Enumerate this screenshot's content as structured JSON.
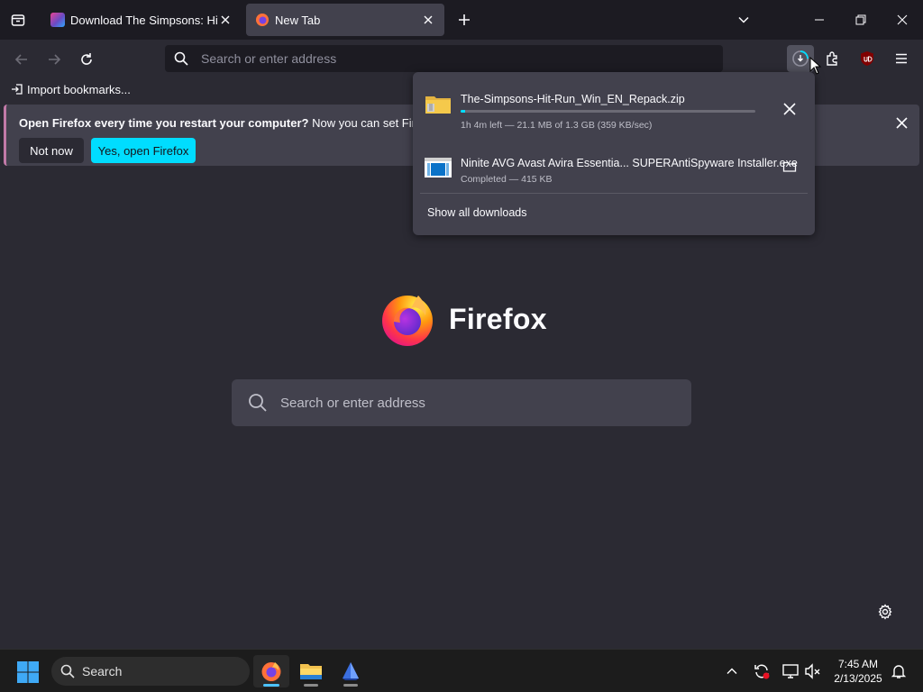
{
  "tabs": [
    {
      "title": "Download The Simpsons: Hit & Run",
      "favicon_color": "#6a4bc4"
    },
    {
      "title": "New Tab",
      "active": true
    }
  ],
  "navbar": {
    "url_placeholder": "Search or enter address"
  },
  "bookmarks_bar": {
    "import_label": "Import bookmarks..."
  },
  "notification": {
    "message_bold": "Open Firefox every time you restart your computer?",
    "message_rest": " Now you can set Firefox to",
    "not_now_label": "Not now",
    "yes_label": "Yes, open Firefox"
  },
  "downloads_panel": {
    "items": [
      {
        "name": "The-Simpsons-Hit-Run_Win_EN_Repack.zip",
        "status": "1h 4m left — 21.1 MB of 1.3 GB (359 KB/sec)",
        "progress_percent": 1.6,
        "action": "cancel"
      },
      {
        "name": "Ninite AVG Avast Avira Essentia... SUPERAntiSpyware Installer.exe",
        "status": "Completed — 415 KB",
        "action": "show-in-folder"
      }
    ],
    "show_all_label": "Show all downloads"
  },
  "content": {
    "logo_text": "Firefox",
    "search_placeholder": "Search or enter address"
  },
  "taskbar": {
    "search_label": "Search",
    "time": "7:45 AM",
    "date": "2/13/2025"
  },
  "colors": {
    "accent": "#00ddff",
    "chrome_bg": "#1c1b22",
    "content_bg": "#2b2a33",
    "panel_bg": "#42414d"
  }
}
